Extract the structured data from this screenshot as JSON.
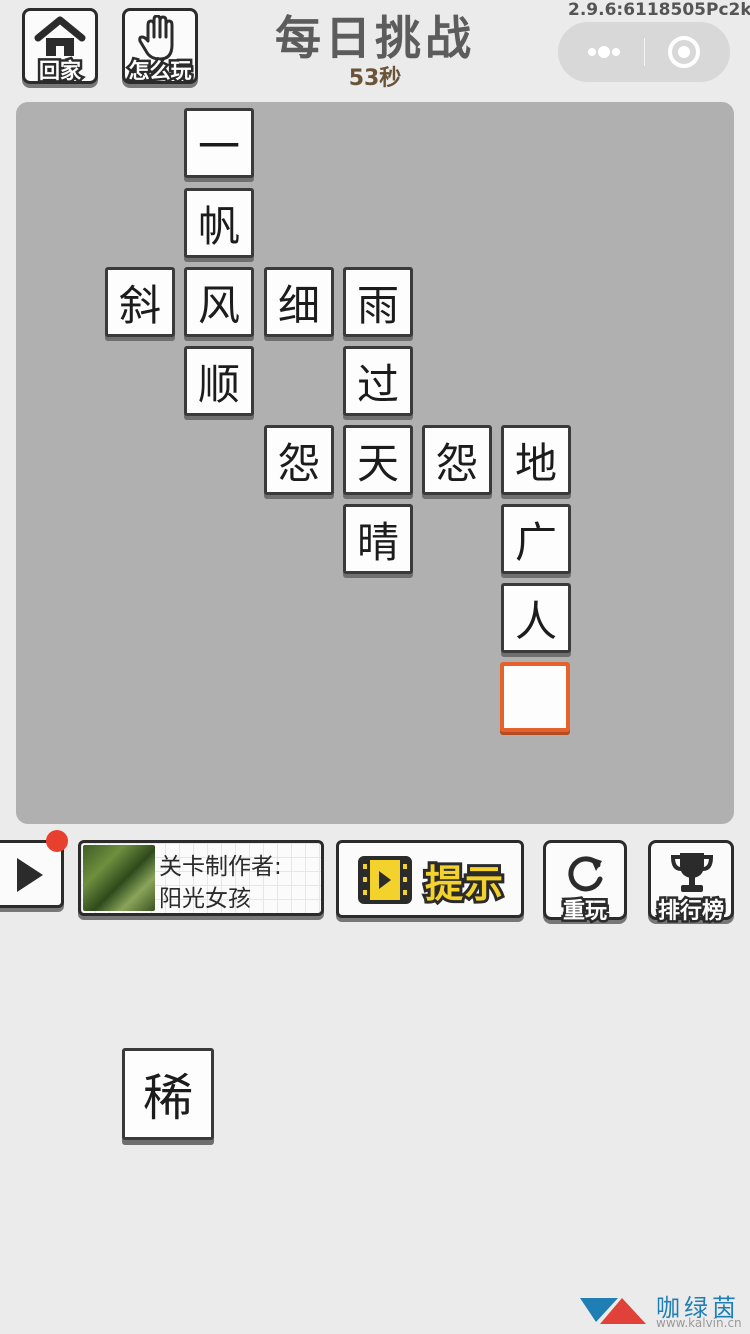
{
  "header": {
    "home_label": "回家",
    "howto_label": "怎么玩",
    "title": "每日挑战",
    "timer": "53秒",
    "version": "2.9.6:6118505Pc2k"
  },
  "board": {
    "tiles": [
      {
        "char": "一"
      },
      {
        "char": "帆"
      },
      {
        "char": "斜"
      },
      {
        "char": "风"
      },
      {
        "char": "细"
      },
      {
        "char": "雨"
      },
      {
        "char": "顺"
      },
      {
        "char": "过"
      },
      {
        "char": "怨"
      },
      {
        "char": "天"
      },
      {
        "char": "怨"
      },
      {
        "char": "地"
      },
      {
        "char": "晴"
      },
      {
        "char": "广"
      },
      {
        "char": "人"
      },
      {
        "char": ""
      }
    ]
  },
  "controls": {
    "author_line1": "关卡制作者:",
    "author_line2": "阳光女孩",
    "hint_label": "提示",
    "restart_label": "重玩",
    "rank_label": "排行榜"
  },
  "choices": [
    "稀"
  ],
  "watermark": {
    "name": "咖绿茵",
    "url": "www.kalvin.cn"
  },
  "colors": {
    "active_border": "#e5622d",
    "hint_text": "#f4d22c",
    "notify_dot": "#e8402e",
    "board_bg": "#b0b0b0"
  }
}
